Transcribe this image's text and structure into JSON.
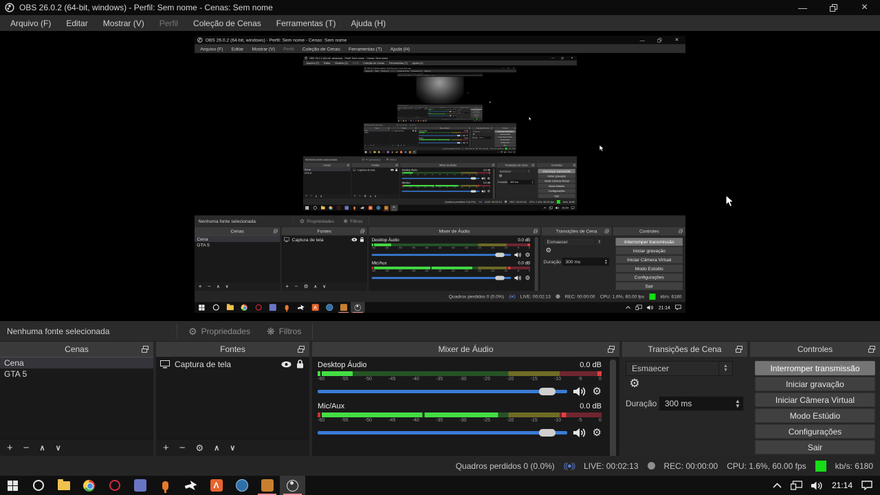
{
  "window": {
    "title": "OBS 26.0.2 (64-bit, windows) - Perfil: Sem nome - Cenas: Sem nome",
    "minimize": "—",
    "restore": "restore",
    "close": "×"
  },
  "menu": {
    "items": [
      {
        "label": "Arquivo (F)",
        "enabled": true
      },
      {
        "label": "Editar",
        "enabled": true
      },
      {
        "label": "Mostrar (V)",
        "enabled": true
      },
      {
        "label": "Perfil",
        "enabled": false
      },
      {
        "label": "Coleção de Cenas",
        "enabled": true
      },
      {
        "label": "Ferramentas (T)",
        "enabled": true
      },
      {
        "label": "Ajuda (H)",
        "enabled": true
      }
    ]
  },
  "toolbar": {
    "no_source": "Nenhuma fonte selecionada",
    "properties_label": "Propriedades",
    "filters_label": "Filtros"
  },
  "panels": {
    "scenes": {
      "title": "Cenas",
      "items": [
        {
          "label": "Cena",
          "selected": true
        },
        {
          "label": "GTA 5",
          "selected": false
        }
      ]
    },
    "sources": {
      "title": "Fontes",
      "items": [
        {
          "label": "Captura de tela"
        }
      ]
    },
    "mixer": {
      "title": "Mixer de Áudio",
      "ticks": [
        "-60",
        "-55",
        "-50",
        "-45",
        "-40",
        "-35",
        "-30",
        "-25",
        "-20",
        "-15",
        "-10",
        "-5",
        "0"
      ],
      "channels": [
        {
          "name": "Desktop Áudio",
          "db": "0.0 dB",
          "slider_pct": 92,
          "indicator": "#44dd44",
          "segments": [
            {
              "f": 0,
              "t": 11,
              "c": "#44dd44"
            },
            {
              "f": 11,
              "t": 66.7,
              "c": "#265326"
            },
            {
              "f": 66.7,
              "t": 85,
              "c": "#6f6c26"
            },
            {
              "f": 85,
              "t": 98.5,
              "c": "#6f2630"
            },
            {
              "f": 98.5,
              "t": 100,
              "c": "#e04040"
            }
          ]
        },
        {
          "name": "Mic/Aux",
          "db": "0.0 dB",
          "slider_pct": 92,
          "indicator": "#cc3333",
          "segments": [
            {
              "f": 0,
              "t": 36,
              "c": "#44dd44"
            },
            {
              "f": 36,
              "t": 36.7,
              "c": "#102810"
            },
            {
              "f": 36.7,
              "t": 63,
              "c": "#44dd44"
            },
            {
              "f": 63,
              "t": 66.7,
              "c": "#265326"
            },
            {
              "f": 66.7,
              "t": 85,
              "c": "#6f6c26"
            },
            {
              "f": 85,
              "t": 85.8,
              "c": "#6f2630"
            },
            {
              "f": 85.8,
              "t": 87.4,
              "c": "#e04040"
            },
            {
              "f": 87.4,
              "t": 100,
              "c": "#6f2630"
            }
          ]
        }
      ]
    },
    "transitions": {
      "title": "Transições de Cena",
      "transition_value": "Esmaecer",
      "duration_label": "Duração",
      "duration_value": "300 ms"
    },
    "controls": {
      "title": "Controles",
      "buttons": [
        {
          "label": "Interromper transmissão",
          "active": true
        },
        {
          "label": "Iniciar gravação",
          "active": false
        },
        {
          "label": "Iniciar Câmera Virtual",
          "active": false
        },
        {
          "label": "Modo Estúdio",
          "active": false
        },
        {
          "label": "Configurações",
          "active": false
        },
        {
          "label": "Sair",
          "active": false
        }
      ]
    }
  },
  "status": {
    "dropped": "Quadros perdidos 0 (0.0%)",
    "live_icon": "((●))",
    "live": "LIVE: 00:02:13",
    "rec": "REC: 00:00:00",
    "cpu": "CPU: 1.6%, 60.00 fps",
    "bitrate": "kb/s: 6180",
    "status_green": "#16dd16"
  },
  "taskbar": {
    "clock": "21:14",
    "icons": [
      {
        "name": "start-button",
        "type": "win"
      },
      {
        "name": "search-icon",
        "type": "ring",
        "color": "#e6e6e6"
      },
      {
        "name": "file-explorer-icon",
        "type": "folder",
        "color": "#f0c14f"
      },
      {
        "name": "chrome-icon",
        "type": "chrome"
      },
      {
        "name": "opera-icon",
        "type": "ring",
        "color": "#d6293e"
      },
      {
        "name": "discord-icon",
        "type": "square",
        "color": "#6a76c4"
      },
      {
        "name": "mic-app-icon",
        "type": "mic",
        "color": "#e87a2c"
      },
      {
        "name": "jet-app-icon",
        "type": "bird",
        "color": "#f0f0f0"
      },
      {
        "name": "lambda-app-icon",
        "type": "square",
        "color": "#e8642c",
        "glyph": "Λ"
      },
      {
        "name": "headset-app-icon",
        "type": "circle",
        "color": "#2f6fa8"
      },
      {
        "name": "csgo-icon",
        "type": "square",
        "color": "#c8802e",
        "running": true
      },
      {
        "name": "obs-icon",
        "type": "obsring",
        "running": true,
        "focused": true
      }
    ]
  }
}
